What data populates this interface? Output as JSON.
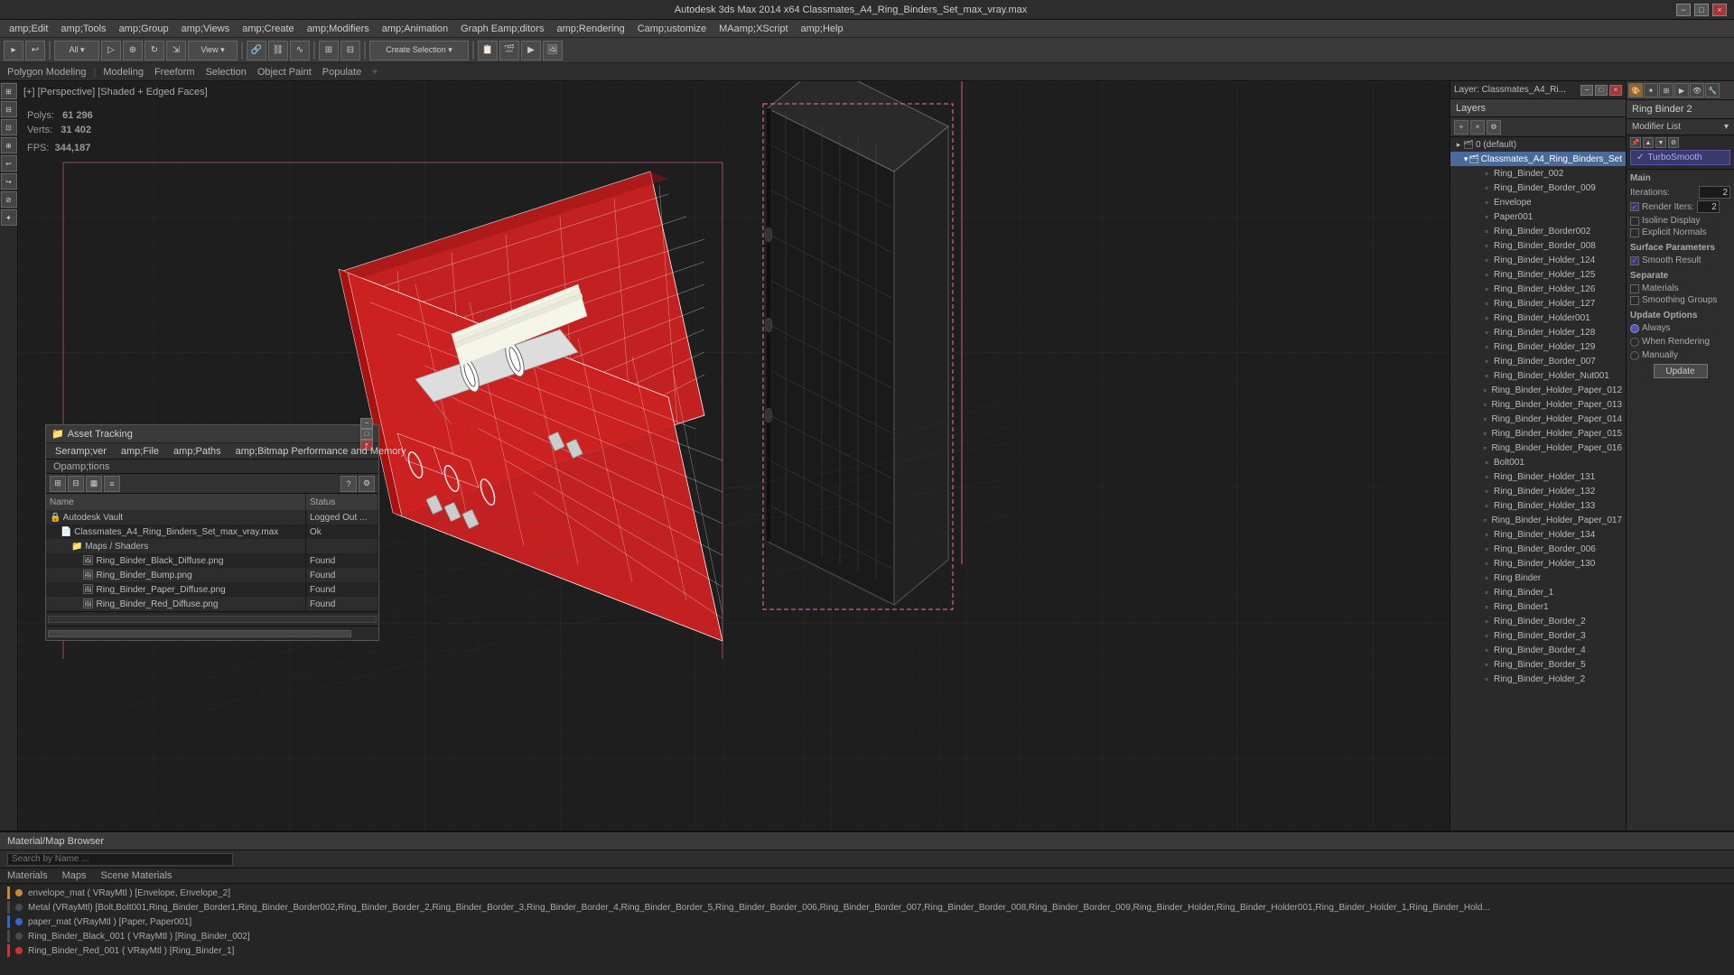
{
  "titlebar": {
    "text": "Autodesk 3ds Max 2014 x64   Classmates_A4_Ring_Binders_Set_max_vray.max",
    "min": "−",
    "max": "□",
    "close": "×"
  },
  "layer_window": {
    "title": "Layer: Classmates_A4_Ri...",
    "min": "−",
    "max": "□",
    "close": "×"
  },
  "menu": {
    "items": [
      "amp;Edit",
      "amp;Tools",
      "amp;Group",
      "amp;Views",
      "amp;Create",
      "amp;Modifiers",
      "amp;Animation",
      "Graph Eamp;ditors",
      "amp;Rendering",
      "Camp;ustomize",
      "MAamp;XScript",
      "amp;Help"
    ]
  },
  "viewport": {
    "label": "[+] [Perspective] [Shaded + Edged Faces]",
    "stats": {
      "polys_label": "Polys:",
      "polys_value": "61 296",
      "verts_label": "Verts:",
      "verts_value": "31 402",
      "fps_label": "FPS:",
      "fps_value": "344,187"
    }
  },
  "layers": {
    "header": "Layers",
    "items": [
      {
        "label": "0 (default)",
        "level": 0,
        "type": "layer",
        "selected": false
      },
      {
        "label": "Classmates_A4_Ring_Binders_Set",
        "level": 1,
        "type": "layer",
        "selected": true,
        "highlight": true
      },
      {
        "label": "Ring_Binder_002",
        "level": 2,
        "type": "mesh"
      },
      {
        "label": "Ring_Binder_Border_009",
        "level": 2,
        "type": "mesh"
      },
      {
        "label": "Envelope",
        "level": 2,
        "type": "mesh"
      },
      {
        "label": "Paper001",
        "level": 2,
        "type": "mesh"
      },
      {
        "label": "Ring_Binder_Border002",
        "level": 2,
        "type": "mesh"
      },
      {
        "label": "Ring_Binder_Border_008",
        "level": 2,
        "type": "mesh"
      },
      {
        "label": "Ring_Binder_Holder_124",
        "level": 2,
        "type": "mesh"
      },
      {
        "label": "Ring_Binder_Holder_125",
        "level": 2,
        "type": "mesh"
      },
      {
        "label": "Ring_Binder_Holder_126",
        "level": 2,
        "type": "mesh"
      },
      {
        "label": "Ring_Binder_Holder_127",
        "level": 2,
        "type": "mesh"
      },
      {
        "label": "Ring_Binder_Holder001",
        "level": 2,
        "type": "mesh"
      },
      {
        "label": "Ring_Binder_Holder_128",
        "level": 2,
        "type": "mesh"
      },
      {
        "label": "Ring_Binder_Holder_129",
        "level": 2,
        "type": "mesh"
      },
      {
        "label": "Ring_Binder_Border_007",
        "level": 2,
        "type": "mesh"
      },
      {
        "label": "Ring_Binder_Holder_Nut001",
        "level": 2,
        "type": "mesh"
      },
      {
        "label": "Ring_Binder_Holder_Paper_012",
        "level": 2,
        "type": "mesh"
      },
      {
        "label": "Ring_Binder_Holder_Paper_013",
        "level": 2,
        "type": "mesh"
      },
      {
        "label": "Ring_Binder_Holder_Paper_014",
        "level": 2,
        "type": "mesh"
      },
      {
        "label": "Ring_Binder_Holder_Paper_015",
        "level": 2,
        "type": "mesh"
      },
      {
        "label": "Ring_Binder_Holder_Paper_016",
        "level": 2,
        "type": "mesh"
      },
      {
        "label": "Bolt001",
        "level": 2,
        "type": "mesh"
      },
      {
        "label": "Ring_Binder_Holder_131",
        "level": 2,
        "type": "mesh"
      },
      {
        "label": "Ring_Binder_Holder_132",
        "level": 2,
        "type": "mesh"
      },
      {
        "label": "Ring_Binder_Holder_133",
        "level": 2,
        "type": "mesh"
      },
      {
        "label": "Ring_Binder_Holder_Paper_017",
        "level": 2,
        "type": "mesh"
      },
      {
        "label": "Ring_Binder_Holder_134",
        "level": 2,
        "type": "mesh"
      },
      {
        "label": "Ring_Binder_Border_006",
        "level": 2,
        "type": "mesh"
      },
      {
        "label": "Ring_Binder_Holder_130",
        "level": 2,
        "type": "mesh"
      },
      {
        "label": "Ring Binder",
        "level": 2,
        "type": "mesh"
      },
      {
        "label": "Ring_Binder_1",
        "level": 2,
        "type": "mesh"
      },
      {
        "label": "Ring_Binder1",
        "level": 2,
        "type": "mesh"
      },
      {
        "label": "Ring_Binder_Border_2",
        "level": 2,
        "type": "mesh"
      },
      {
        "label": "Ring_Binder_Border_3",
        "level": 2,
        "type": "mesh"
      },
      {
        "label": "Ring_Binder_Border_4",
        "level": 2,
        "type": "mesh"
      },
      {
        "label": "Ring_Binder_Border_5",
        "level": 2,
        "type": "mesh"
      },
      {
        "label": "Ring_Binder_Holder_2",
        "level": 2,
        "type": "mesh"
      }
    ]
  },
  "modifier_panel": {
    "header": "Ring Binder 2",
    "modifier_list_label": "Modifier List",
    "modifier_name": "TurboSmooth",
    "sections": {
      "main": {
        "label": "Main",
        "iterations_label": "Iterations:",
        "iterations_value": "2",
        "render_iters_label": "Render Iters:",
        "render_iters_value": "2",
        "isolate_display": "Isoline Display",
        "explicit_normals": "Explicit Normals"
      },
      "surface": {
        "label": "Surface Parameters",
        "smooth_result": "Smooth Result"
      },
      "separate": {
        "label": "Separate",
        "materials": "Materials",
        "smoothing_groups": "Smoothing Groups"
      },
      "update": {
        "label": "Update Options",
        "always": "Always",
        "when_rendering": "When Rendering",
        "manually": "Manually",
        "update_btn": "Update"
      }
    }
  },
  "asset_tracking": {
    "title": "Asset Tracking",
    "icon": "📁",
    "menu_items": [
      "Seramp;ver",
      "amp;File",
      "amp;Paths",
      "amp;Bitmap Performance and Memory"
    ],
    "sub_menu": [
      "Opamp;tions"
    ],
    "columns": [
      {
        "label": "Name"
      },
      {
        "label": "Status"
      }
    ],
    "files": [
      {
        "indent": 0,
        "name": "Autodesk Vault",
        "status": "Logged Out ...",
        "status_class": "status-logged-out"
      },
      {
        "indent": 1,
        "name": "Classmates_A4_Ring_Binders_Set_max_vray.max",
        "status": "Ok",
        "status_class": "status-ok"
      },
      {
        "indent": 2,
        "name": "Maps / Shaders",
        "status": "",
        "status_class": ""
      },
      {
        "indent": 3,
        "name": "Ring_Binder_Black_Diffuse.png",
        "status": "Found",
        "status_class": "status-ok"
      },
      {
        "indent": 3,
        "name": "Ring_Binder_Bump.png",
        "status": "Found",
        "status_class": "status-ok"
      },
      {
        "indent": 3,
        "name": "Ring_Binder_Paper_Diffuse.png",
        "status": "Found",
        "status_class": "status-ok"
      },
      {
        "indent": 3,
        "name": "Ring_Binder_Red_Diffuse.png",
        "status": "Found",
        "status_class": "status-ok"
      }
    ]
  },
  "material_browser": {
    "title": "Material/Map Browser",
    "search_placeholder": "Search by Name ...",
    "sections": [
      "Materials",
      "Maps",
      "Scene Materials"
    ],
    "scene_materials": [
      {
        "color": "orange",
        "name": "envelope_mat ( VRayMtl ) [Envelope, Envelope_2]"
      },
      {
        "color": "dark",
        "name": "Metal (VRayMtl) [Bolt,Bolt001,Ring_Binder_Border1,Ring_Binder_Border002,Ring_Binder_Border_2,Ring_Binder_Border_3,Ring_Binder_Border_4,Ring_Binder_Border_5,Ring_Binder_Border_006,Ring_Binder_Border_007,Ring_Binder_Border_008,Ring_Binder_Border_009,Ring_Binder_Holder,Ring_Binder_Holder001,Ring_Binder_Holder_1,Ring_Binder_Hold..."
      },
      {
        "color": "blue",
        "name": "paper_mat (VRayMtl ) [Paper, Paper001]"
      },
      {
        "color": "dark",
        "name": "Ring_Binder_Black_001 ( VRayMtl ) [Ring_Binder_002]"
      },
      {
        "color": "red",
        "name": "Ring_Binder_Red_001 ( VRayMtl ) [Ring_Binder_1]"
      }
    ]
  },
  "polygon_modeling": {
    "label": "Polygon Modeling"
  },
  "sub_toolbar": {
    "items": [
      "Modeling",
      "Freeform",
      "Selection",
      "Object Paint",
      "Populate"
    ]
  }
}
